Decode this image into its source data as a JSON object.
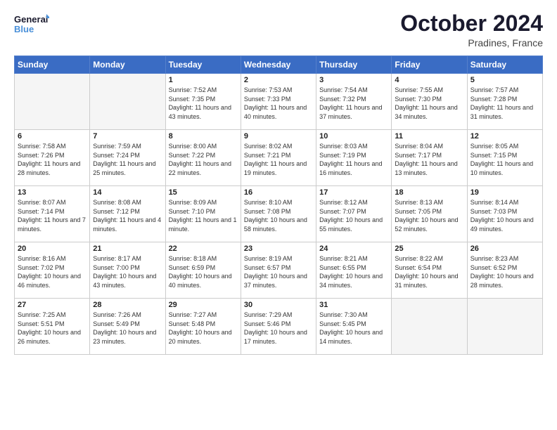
{
  "header": {
    "logo_line1": "General",
    "logo_line2": "Blue",
    "month": "October 2024",
    "location": "Pradines, France"
  },
  "weekdays": [
    "Sunday",
    "Monday",
    "Tuesday",
    "Wednesday",
    "Thursday",
    "Friday",
    "Saturday"
  ],
  "weeks": [
    [
      {
        "day": "",
        "empty": true
      },
      {
        "day": "",
        "empty": true
      },
      {
        "day": "1",
        "sunrise": "7:52 AM",
        "sunset": "7:35 PM",
        "daylight": "11 hours and 43 minutes."
      },
      {
        "day": "2",
        "sunrise": "7:53 AM",
        "sunset": "7:33 PM",
        "daylight": "11 hours and 40 minutes."
      },
      {
        "day": "3",
        "sunrise": "7:54 AM",
        "sunset": "7:32 PM",
        "daylight": "11 hours and 37 minutes."
      },
      {
        "day": "4",
        "sunrise": "7:55 AM",
        "sunset": "7:30 PM",
        "daylight": "11 hours and 34 minutes."
      },
      {
        "day": "5",
        "sunrise": "7:57 AM",
        "sunset": "7:28 PM",
        "daylight": "11 hours and 31 minutes."
      }
    ],
    [
      {
        "day": "6",
        "sunrise": "7:58 AM",
        "sunset": "7:26 PM",
        "daylight": "11 hours and 28 minutes."
      },
      {
        "day": "7",
        "sunrise": "7:59 AM",
        "sunset": "7:24 PM",
        "daylight": "11 hours and 25 minutes."
      },
      {
        "day": "8",
        "sunrise": "8:00 AM",
        "sunset": "7:22 PM",
        "daylight": "11 hours and 22 minutes."
      },
      {
        "day": "9",
        "sunrise": "8:02 AM",
        "sunset": "7:21 PM",
        "daylight": "11 hours and 19 minutes."
      },
      {
        "day": "10",
        "sunrise": "8:03 AM",
        "sunset": "7:19 PM",
        "daylight": "11 hours and 16 minutes."
      },
      {
        "day": "11",
        "sunrise": "8:04 AM",
        "sunset": "7:17 PM",
        "daylight": "11 hours and 13 minutes."
      },
      {
        "day": "12",
        "sunrise": "8:05 AM",
        "sunset": "7:15 PM",
        "daylight": "11 hours and 10 minutes."
      }
    ],
    [
      {
        "day": "13",
        "sunrise": "8:07 AM",
        "sunset": "7:14 PM",
        "daylight": "11 hours and 7 minutes."
      },
      {
        "day": "14",
        "sunrise": "8:08 AM",
        "sunset": "7:12 PM",
        "daylight": "11 hours and 4 minutes."
      },
      {
        "day": "15",
        "sunrise": "8:09 AM",
        "sunset": "7:10 PM",
        "daylight": "11 hours and 1 minute."
      },
      {
        "day": "16",
        "sunrise": "8:10 AM",
        "sunset": "7:08 PM",
        "daylight": "10 hours and 58 minutes."
      },
      {
        "day": "17",
        "sunrise": "8:12 AM",
        "sunset": "7:07 PM",
        "daylight": "10 hours and 55 minutes."
      },
      {
        "day": "18",
        "sunrise": "8:13 AM",
        "sunset": "7:05 PM",
        "daylight": "10 hours and 52 minutes."
      },
      {
        "day": "19",
        "sunrise": "8:14 AM",
        "sunset": "7:03 PM",
        "daylight": "10 hours and 49 minutes."
      }
    ],
    [
      {
        "day": "20",
        "sunrise": "8:16 AM",
        "sunset": "7:02 PM",
        "daylight": "10 hours and 46 minutes."
      },
      {
        "day": "21",
        "sunrise": "8:17 AM",
        "sunset": "7:00 PM",
        "daylight": "10 hours and 43 minutes."
      },
      {
        "day": "22",
        "sunrise": "8:18 AM",
        "sunset": "6:59 PM",
        "daylight": "10 hours and 40 minutes."
      },
      {
        "day": "23",
        "sunrise": "8:19 AM",
        "sunset": "6:57 PM",
        "daylight": "10 hours and 37 minutes."
      },
      {
        "day": "24",
        "sunrise": "8:21 AM",
        "sunset": "6:55 PM",
        "daylight": "10 hours and 34 minutes."
      },
      {
        "day": "25",
        "sunrise": "8:22 AM",
        "sunset": "6:54 PM",
        "daylight": "10 hours and 31 minutes."
      },
      {
        "day": "26",
        "sunrise": "8:23 AM",
        "sunset": "6:52 PM",
        "daylight": "10 hours and 28 minutes."
      }
    ],
    [
      {
        "day": "27",
        "sunrise": "7:25 AM",
        "sunset": "5:51 PM",
        "daylight": "10 hours and 26 minutes."
      },
      {
        "day": "28",
        "sunrise": "7:26 AM",
        "sunset": "5:49 PM",
        "daylight": "10 hours and 23 minutes."
      },
      {
        "day": "29",
        "sunrise": "7:27 AM",
        "sunset": "5:48 PM",
        "daylight": "10 hours and 20 minutes."
      },
      {
        "day": "30",
        "sunrise": "7:29 AM",
        "sunset": "5:46 PM",
        "daylight": "10 hours and 17 minutes."
      },
      {
        "day": "31",
        "sunrise": "7:30 AM",
        "sunset": "5:45 PM",
        "daylight": "10 hours and 14 minutes."
      },
      {
        "day": "",
        "empty": true
      },
      {
        "day": "",
        "empty": true
      }
    ]
  ]
}
